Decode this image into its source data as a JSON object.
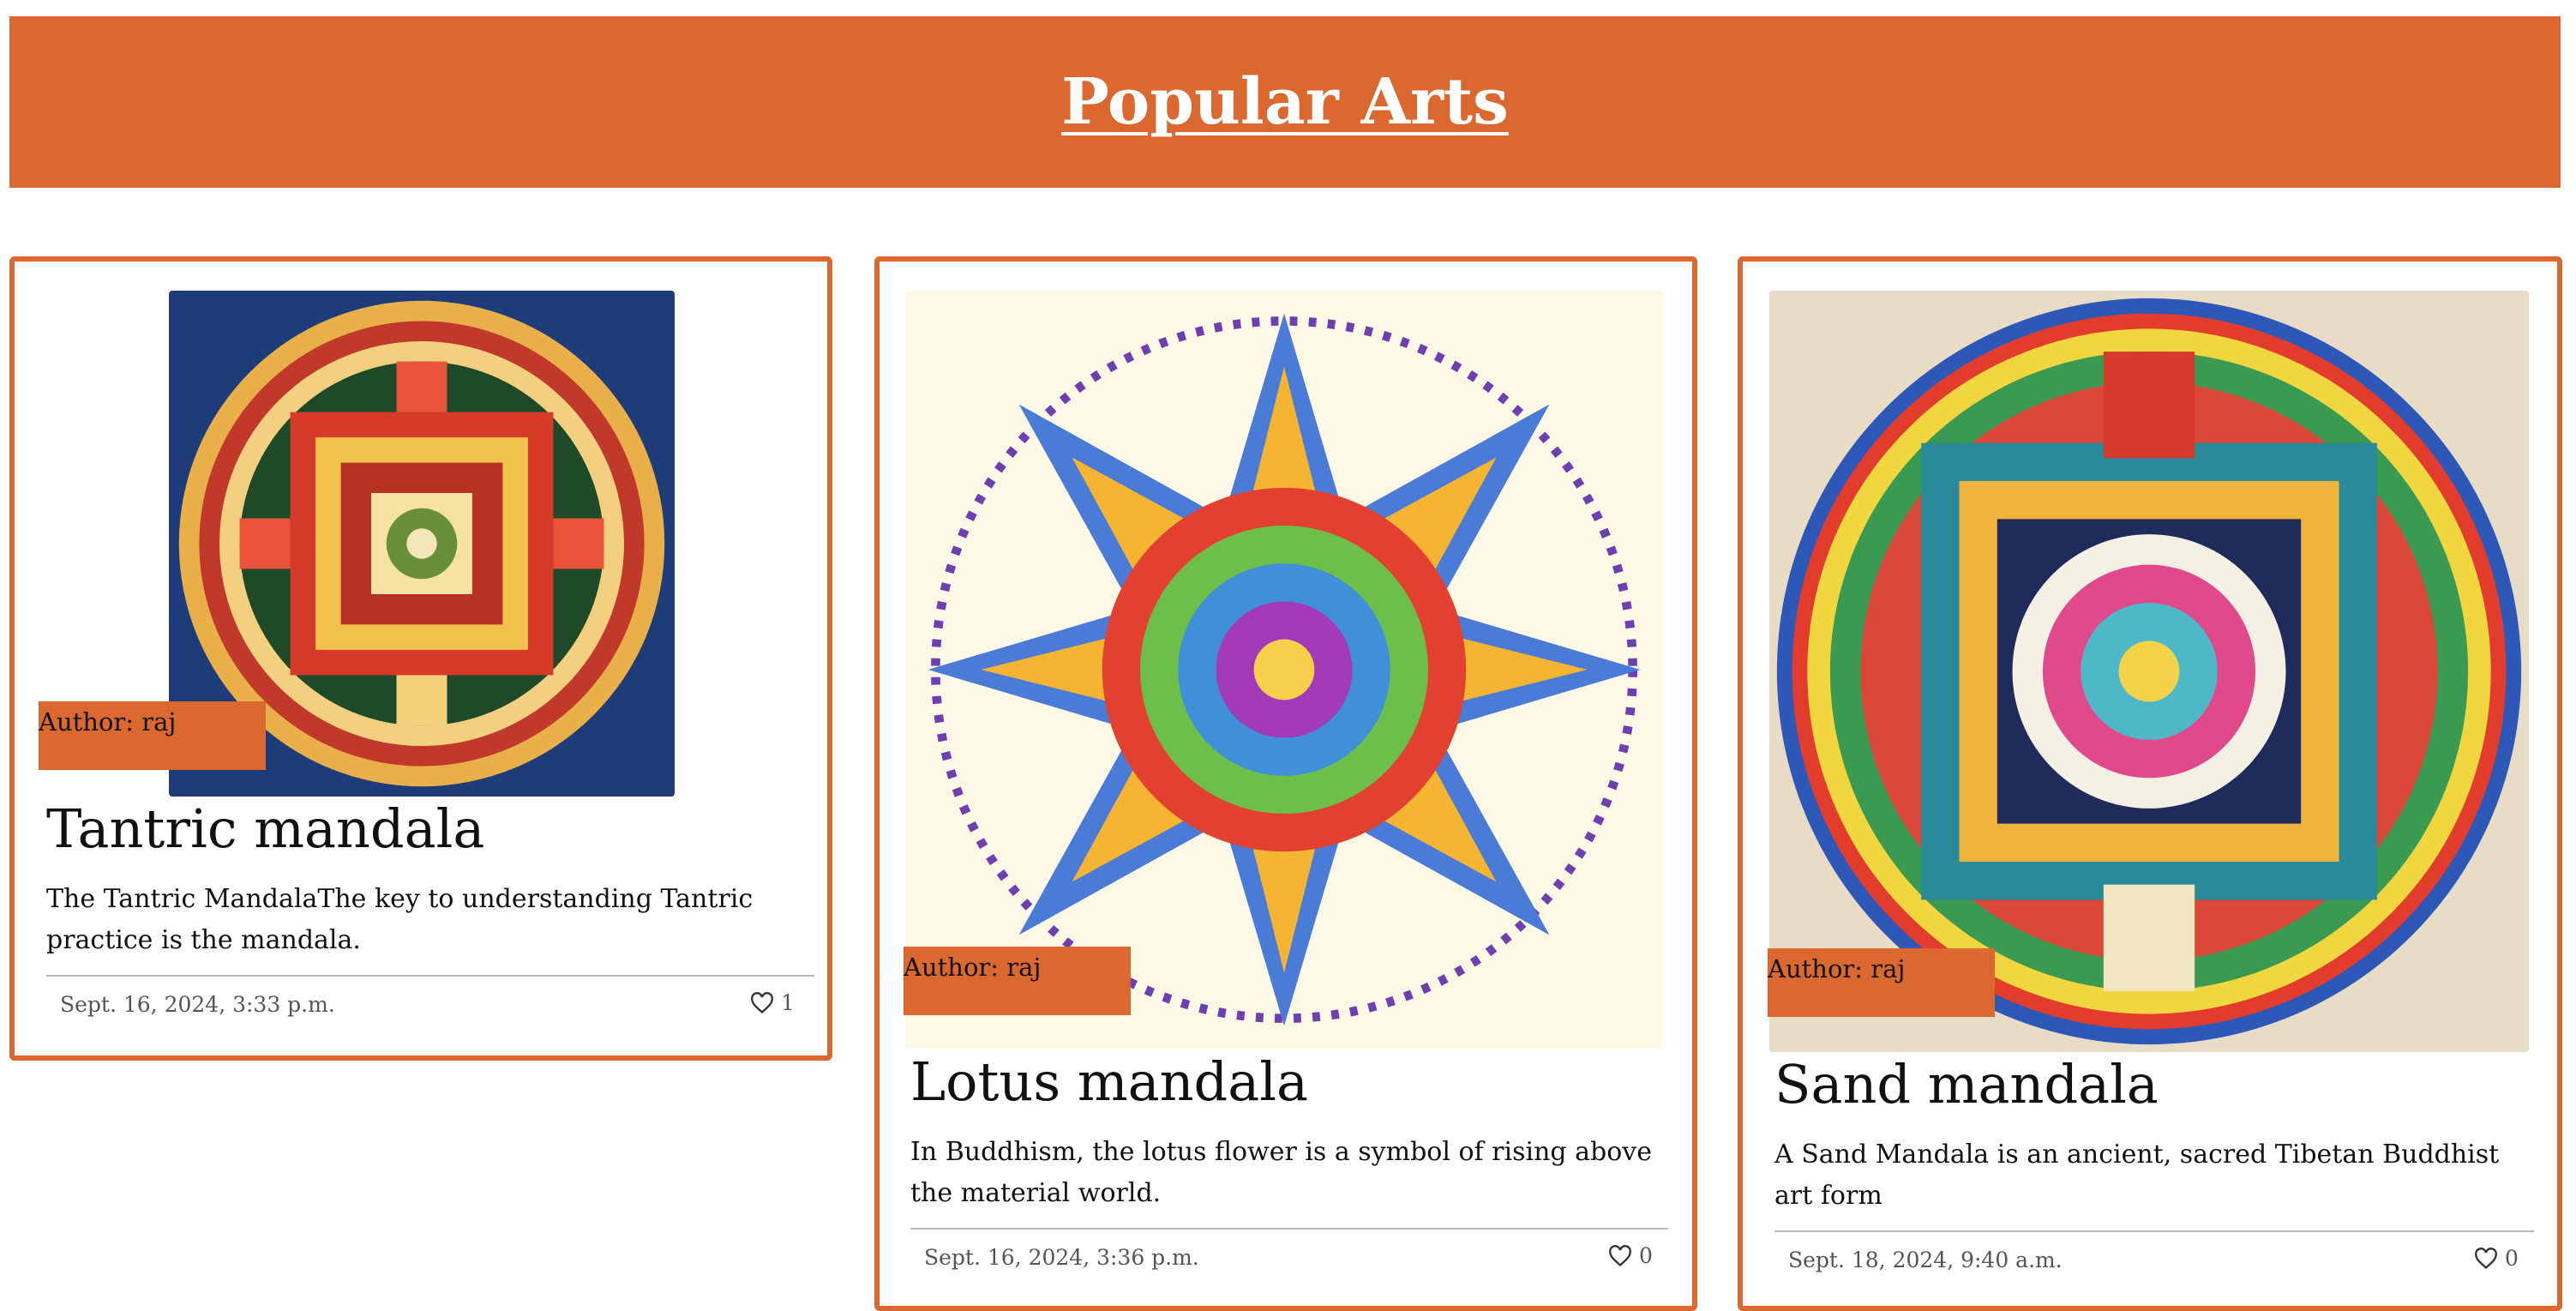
{
  "header": {
    "title": "Popular Arts"
  },
  "cards": [
    {
      "author": "Author: raj",
      "title": "Tantric mandala",
      "description": "The Tantric MandalaThe key to understanding Tantric practice is the mandala.",
      "date": "Sept. 16, 2024, 3:33 p.m.",
      "likes": "1",
      "like_icon": "heart-outline-icon"
    },
    {
      "author": "Author: raj",
      "title": "Lotus mandala",
      "description": "In Buddhism, the lotus flower is a symbol of rising above the material world.",
      "date": "Sept. 16, 2024, 3:36 p.m.",
      "likes": "0",
      "like_icon": "heart-outline-icon"
    },
    {
      "author": "Author: raj",
      "title": "Sand mandala",
      "description": "A Sand Mandala is an ancient, sacred Tibetan Buddhist art form",
      "date": "Sept. 18, 2024, 9:40 a.m.",
      "likes": "0",
      "like_icon": "heart-outline-icon"
    }
  ],
  "colors": {
    "accent": "#db692f",
    "text": "#111111",
    "muted": "#555555"
  }
}
